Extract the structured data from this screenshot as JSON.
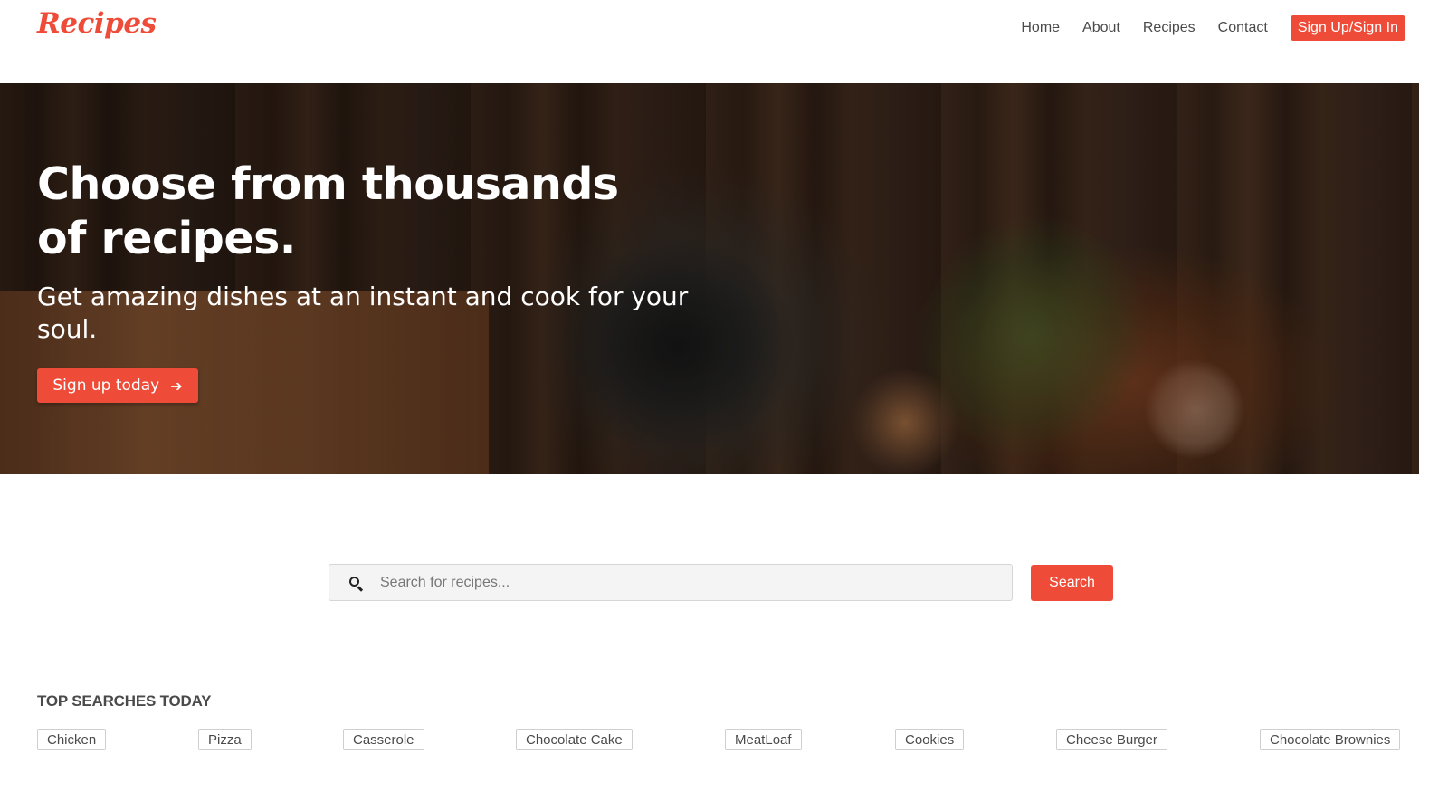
{
  "header": {
    "logo": "Recipes",
    "nav": {
      "home": "Home",
      "about": "About",
      "recipes": "Recipes",
      "contact": "Contact",
      "signin": "Sign Up/Sign In"
    }
  },
  "hero": {
    "title": "Choose from thousands of recipes.",
    "subtitle": "Get amazing dishes at an instant and cook for your soul.",
    "button": "Sign up today",
    "button_icon": "arrow-right-icon"
  },
  "search": {
    "placeholder": "Search for recipes...",
    "value": "",
    "button": "Search",
    "icon": "search-icon"
  },
  "top_searches": {
    "title": "TOP SEARCHES TODAY",
    "tags": [
      "Chicken",
      "Pizza",
      "Casserole",
      "Chocolate Cake",
      "MeatLoaf",
      "Cookies",
      "Cheese Burger",
      "Chocolate Brownies"
    ]
  },
  "colors": {
    "accent": "#ee4c38",
    "text": "#4a4a4a"
  }
}
